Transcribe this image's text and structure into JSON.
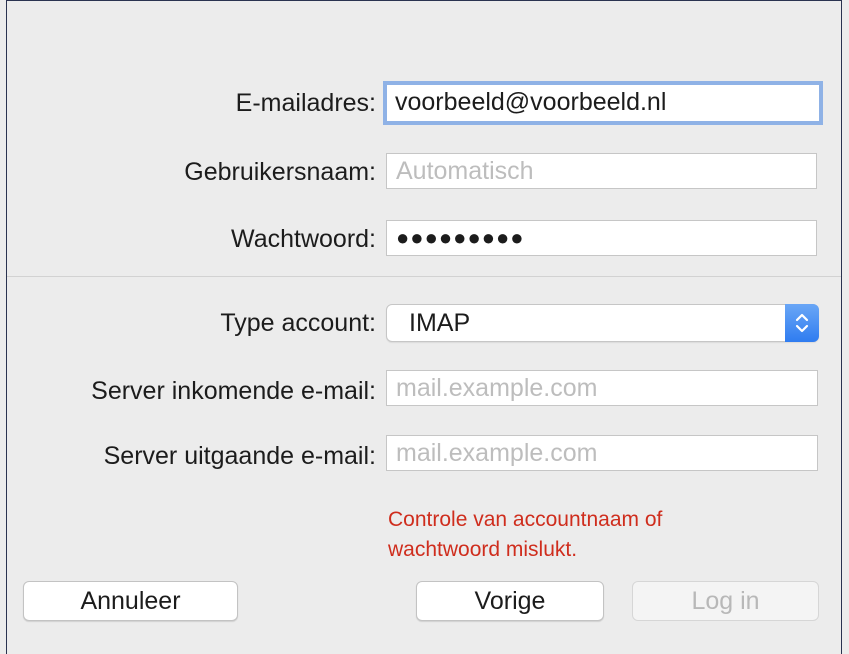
{
  "form": {
    "email": {
      "label": "E-mailadres:",
      "value": "voorbeeld@voorbeeld.nl"
    },
    "username": {
      "label": "Gebruikersnaam:",
      "placeholder": "Automatisch"
    },
    "password": {
      "label": "Wachtwoord:",
      "masked": "●●●●●●●●●"
    },
    "account_type": {
      "label": "Type account:",
      "selected": "IMAP"
    },
    "incoming": {
      "label": "Server inkomende e-mail:",
      "placeholder": "mail.example.com"
    },
    "outgoing": {
      "label": "Server uitgaande e-mail:",
      "placeholder": "mail.example.com"
    }
  },
  "error": {
    "line1": "Controle van accountnaam of",
    "line2": "wachtwoord mislukt.",
    "color": "#cf2d1d"
  },
  "buttons": {
    "cancel": "Annuleer",
    "back": "Vorige",
    "login": "Log in"
  },
  "icons": {
    "select_arrows": "up-down-chevron-icon"
  },
  "colors": {
    "focus_ring": "#8fb2e6",
    "select_accent": "#2f7cf0",
    "window_bg": "#ececec"
  }
}
